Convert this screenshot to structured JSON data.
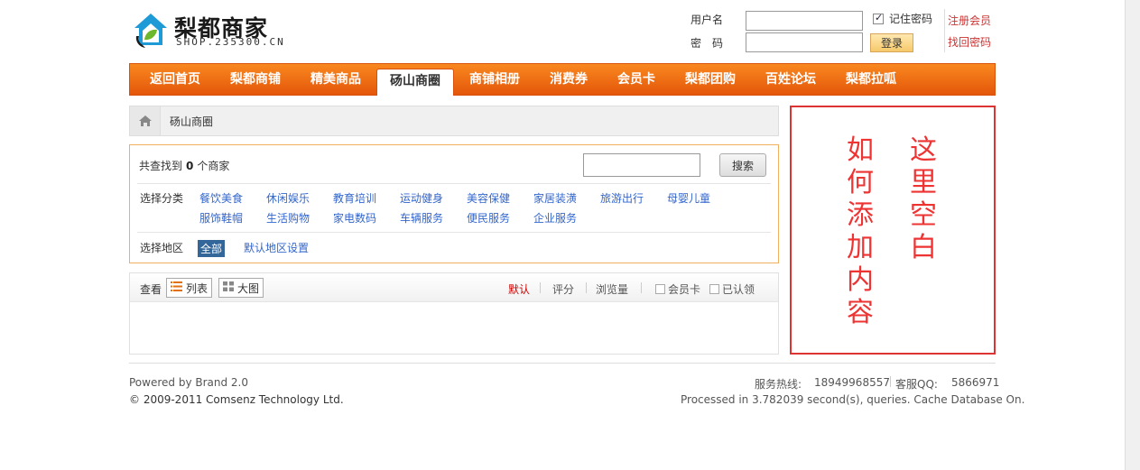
{
  "logo": {
    "title": "梨都商家",
    "subtitle": "SHOP.235300.CN"
  },
  "login": {
    "username_label": "用户名",
    "password_label": "密　码",
    "username_value": "",
    "password_value": "",
    "remember_label": "记住密码",
    "remember_checked": true,
    "login_button": "登录",
    "register_link": "注册会员",
    "forgot_link": "找回密码"
  },
  "nav": {
    "items": [
      {
        "label": "返回首页"
      },
      {
        "label": "梨都商铺"
      },
      {
        "label": "精美商品"
      },
      {
        "label": "砀山商圈",
        "active": true
      },
      {
        "label": "商铺相册"
      },
      {
        "label": "消费券"
      },
      {
        "label": "会员卡"
      },
      {
        "label": "梨都团购"
      },
      {
        "label": "百姓论坛"
      },
      {
        "label": "梨都拉呱"
      }
    ]
  },
  "breadcrumb": {
    "current": "砀山商圈"
  },
  "filter": {
    "found_prefix": "共查找到",
    "found_count": "0",
    "found_suffix": "个商家",
    "search_value": "",
    "search_button": "搜索",
    "category_label": "选择分类",
    "categories_row1": [
      "餐饮美食",
      "休闲娱乐",
      "教育培训",
      "运动健身",
      "美容保健",
      "家居装潢",
      "旅游出行",
      "母婴儿童"
    ],
    "categories_row2": [
      "服饰鞋帽",
      "生活购物",
      "家电数码",
      "车辆服务",
      "便民服务",
      "企业服务"
    ],
    "region_label": "选择地区",
    "region_all": "全部",
    "region_settings": "默认地区设置"
  },
  "listview": {
    "view_label": "查看",
    "list_button": "列表",
    "grid_button": "大图",
    "sort_default": "默认",
    "sort_rating": "评分",
    "sort_views": "浏览量",
    "filter_membercard": "会员卡",
    "filter_verified": "已认领"
  },
  "sidebox": {
    "col1": [
      "这",
      "里",
      "空",
      "白"
    ],
    "col2": [
      "如",
      "何",
      "添",
      "加",
      "内",
      "容"
    ]
  },
  "footer": {
    "powered": "Powered by Brand 2.0",
    "copyright": "© 2009-2011 Comsenz Technology Ltd.",
    "hotline_label": "服务热线:",
    "hotline": "18949968557",
    "qq_label": "客服QQ:",
    "qq": "5866971",
    "processed": "Processed in 3.782039 second(s), queries. Cache Database On."
  },
  "colors": {
    "nav_orange": "#f07a17",
    "link_blue": "#3366cc",
    "accent_red": "#dd3333"
  }
}
